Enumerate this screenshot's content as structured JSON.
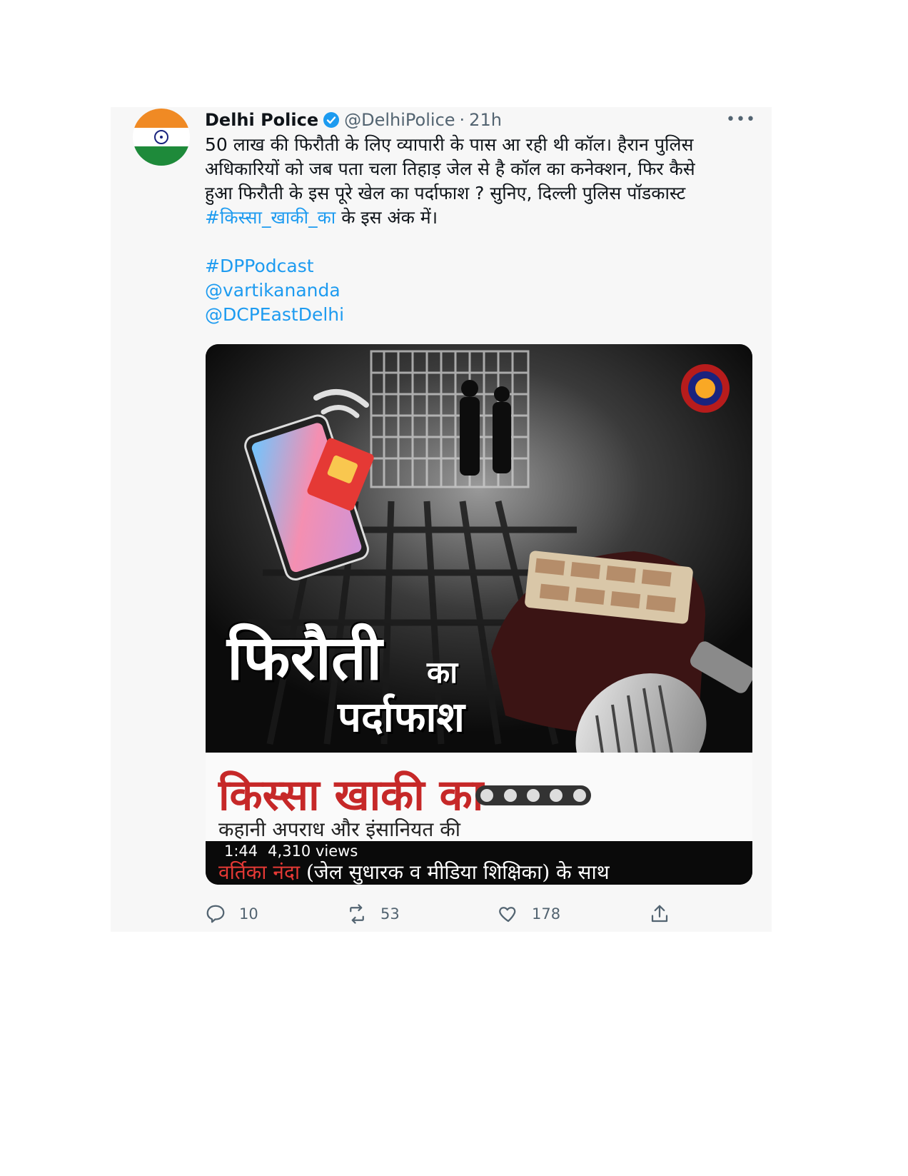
{
  "tweet": {
    "author_name": "Delhi Police",
    "handle": "@DelhiPolice",
    "separator": "·",
    "time": "21h",
    "more_label": "•••",
    "body_line1": "50 लाख की फिरौती के लिए व्यापारी के पास आ रही थी कॉल। हैरान पुलिस",
    "body_line2": "अधिकारियों को जब पता चला तिहाड़ जेल से है कॉल का कनेक्शन, फिर कैसे",
    "body_line3": "हुआ फिरौती के इस पूरे खेल का पर्दाफाश ? सुनिए, दिल्ली पुलिस पॉडकास्ट",
    "body_hashtag": "#किस्सा_खाकी_का",
    "body_line4_rest": " के इस अंक में।",
    "tag1": "#DPPodcast",
    "tag2": "@vartikananda",
    "tag3": "@DCPEastDelhi"
  },
  "media": {
    "headline_main": "फिरौती",
    "headline_connector": "का",
    "headline_sub": "पर्दाफाश",
    "series_title": "किस्सा खाकी का",
    "tagline": "कहानी अपराध और इंसानियत की",
    "duration": "1:44",
    "views": "4,310 views",
    "caption_name": "वर्तिका नंदा",
    "caption_rest": " (जेल सुधारक व मीडिया शिक्षिका) के साथ"
  },
  "actions": {
    "replies": "10",
    "retweets": "53",
    "likes": "178"
  },
  "colors": {
    "link": "#1d9bf0",
    "verified": "#1d9bf0",
    "series_red": "#c62828",
    "muted": "#536471"
  },
  "icons": [
    "verified-badge-icon",
    "more-icon",
    "reply-icon",
    "retweet-icon",
    "like-icon",
    "share-icon",
    "delhi-police-emblem-icon"
  ]
}
